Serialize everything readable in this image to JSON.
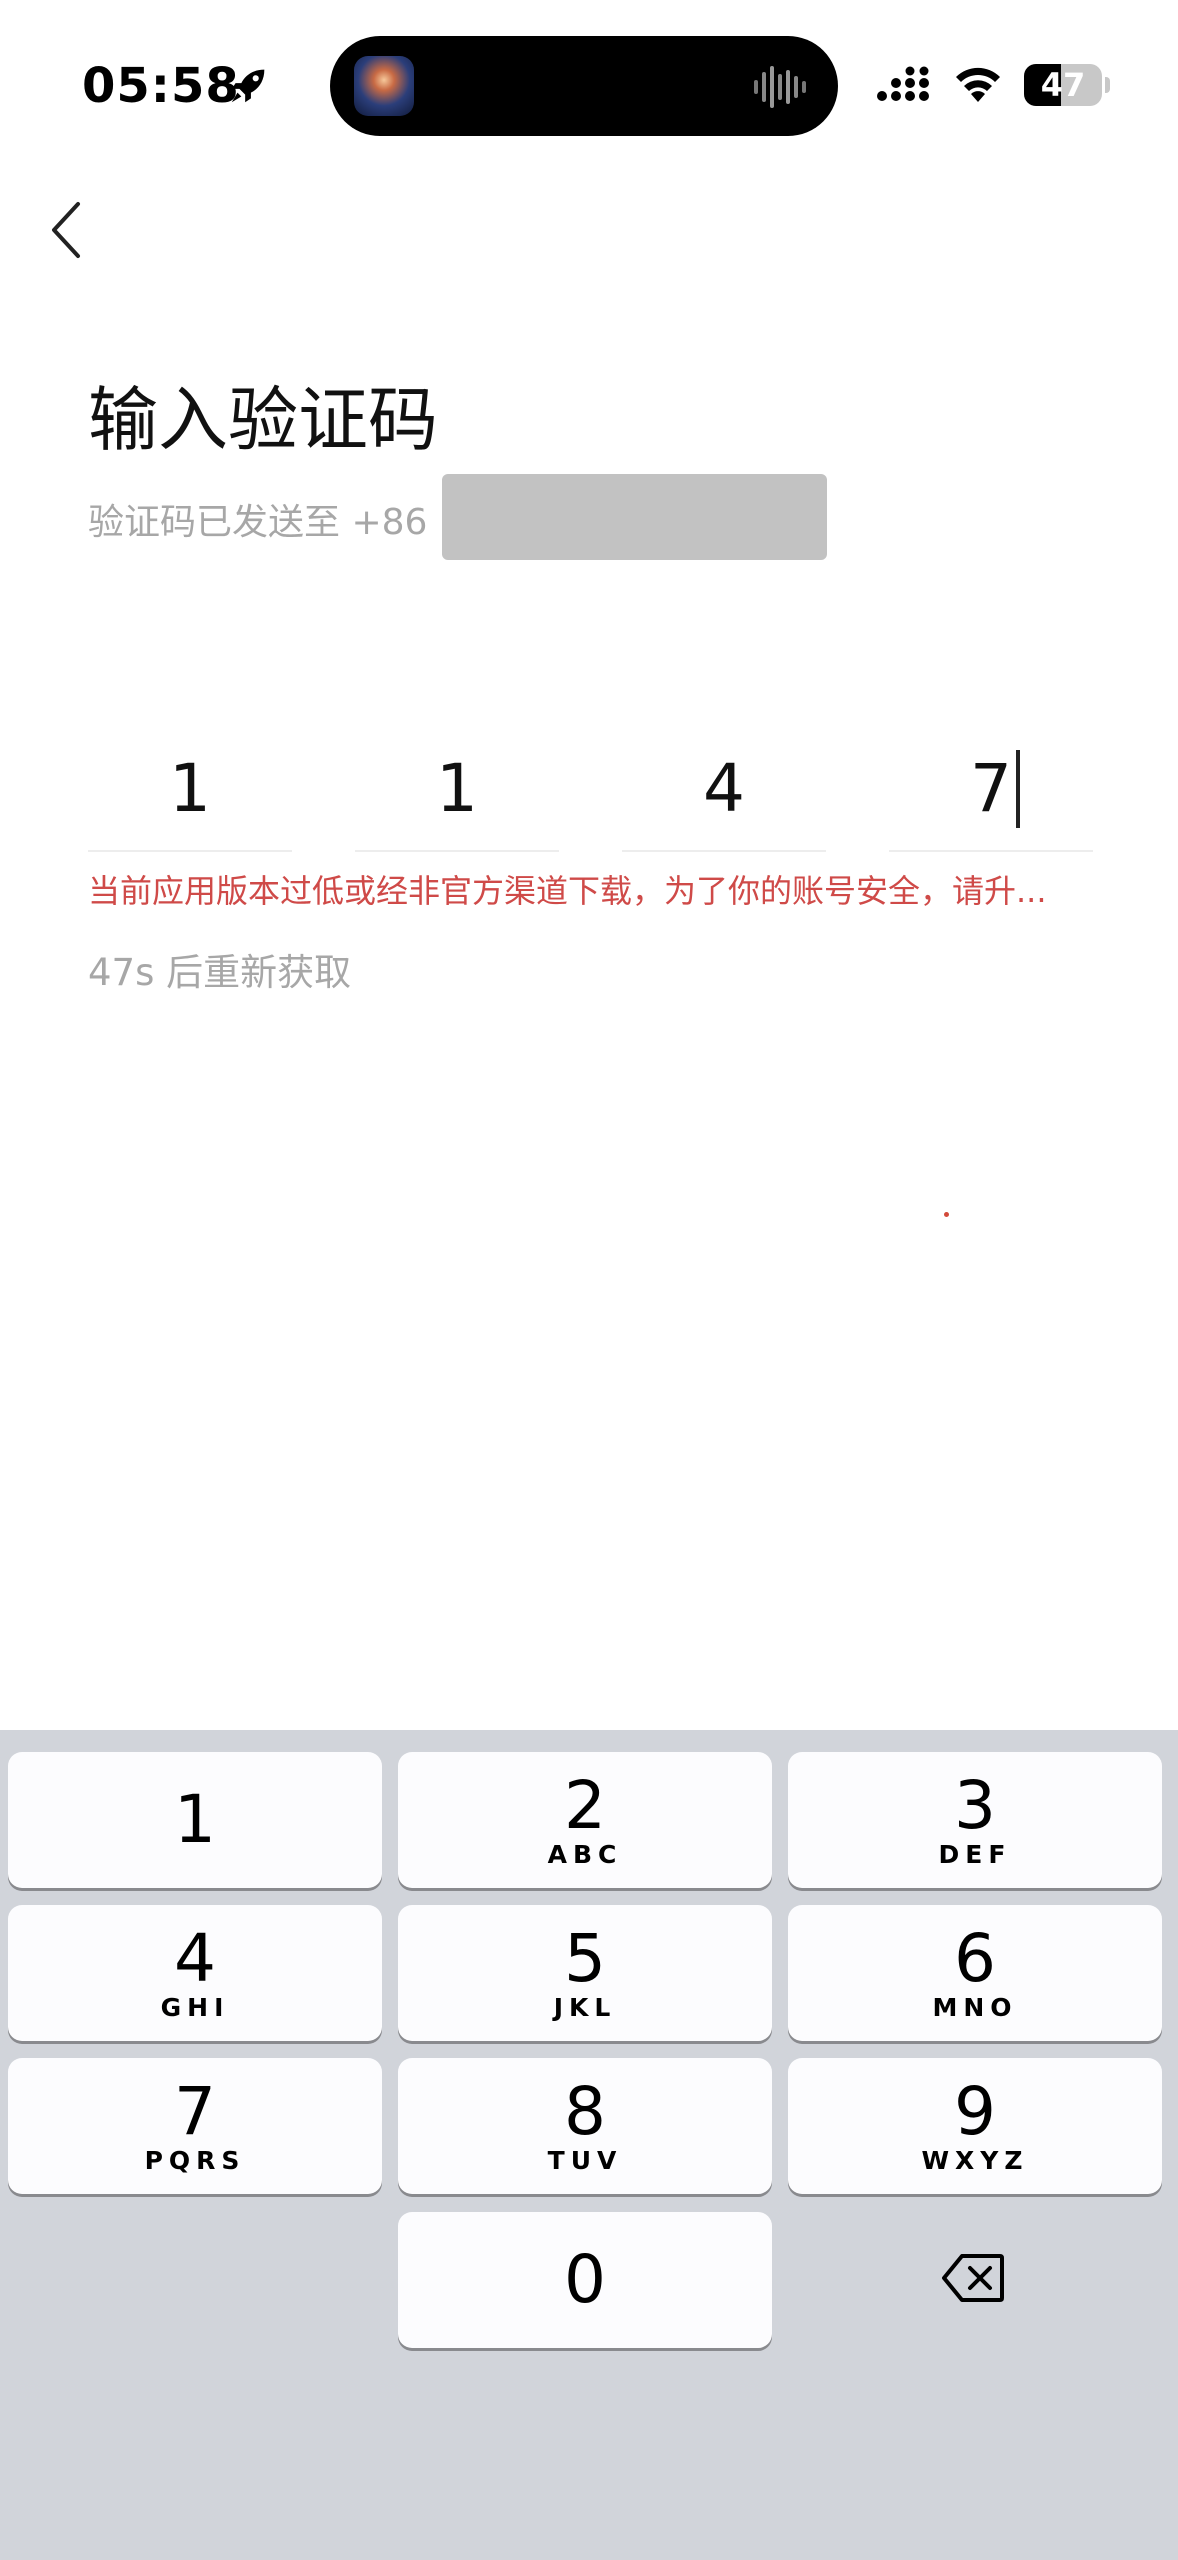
{
  "status_bar": {
    "time": "05:58",
    "battery_level": "47",
    "battery_fraction": 0.47
  },
  "header": {
    "title": "输入验证码",
    "subtitle": "验证码已发送至 +86"
  },
  "code": {
    "digits": [
      "1",
      "1",
      "4",
      "7"
    ]
  },
  "messages": {
    "error": "当前应用版本过低或经非官方渠道下载，为了你的账号安全，请升...",
    "resend": "47s 后重新获取"
  },
  "keyboard": {
    "keys": [
      {
        "digit": "1",
        "letters": ""
      },
      {
        "digit": "2",
        "letters": "ABC"
      },
      {
        "digit": "3",
        "letters": "DEF"
      },
      {
        "digit": "4",
        "letters": "GHI"
      },
      {
        "digit": "5",
        "letters": "JKL"
      },
      {
        "digit": "6",
        "letters": "MNO"
      },
      {
        "digit": "7",
        "letters": "PQRS"
      },
      {
        "digit": "8",
        "letters": "TUV"
      },
      {
        "digit": "9",
        "letters": "WXYZ"
      },
      {
        "digit": "0",
        "letters": ""
      }
    ]
  },
  "colors": {
    "error": "#cf4a48",
    "muted_text": "#a7a7a7",
    "keyboard_bg": "#d1d4da",
    "key_bg": "#fcfcfe"
  },
  "icons": {
    "back": "chevron-left-icon",
    "delete": "backspace-icon",
    "status": [
      "rocket-icon",
      "signal-icon",
      "wifi-icon",
      "battery-icon"
    ]
  }
}
